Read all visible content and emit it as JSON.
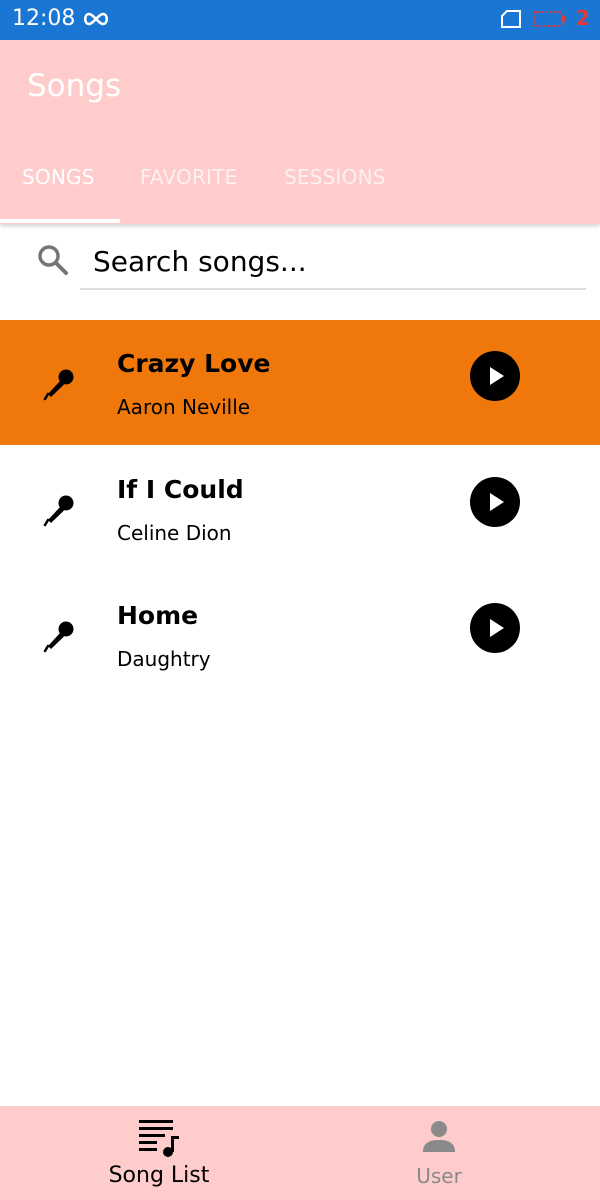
{
  "status_bar": {
    "time": "12:08",
    "battery_level": "2",
    "color": "#1976D2"
  },
  "app_bar": {
    "title": "Songs",
    "color": "#FFCCCC",
    "tabs": [
      {
        "label": "SONGS",
        "active": true
      },
      {
        "label": "FAVORITE",
        "active": false
      },
      {
        "label": "SESSIONS",
        "active": false
      }
    ]
  },
  "search": {
    "placeholder": "Search songs...",
    "value": "",
    "icon": "search-icon"
  },
  "songs": [
    {
      "title": "Crazy Love",
      "artist": "Aaron Neville",
      "selected": true,
      "icon": "microphone-icon"
    },
    {
      "title": "If I Could",
      "artist": "Celine Dion",
      "selected": false,
      "icon": "microphone-icon"
    },
    {
      "title": "Home",
      "artist": "Daughtry",
      "selected": false,
      "icon": "microphone-icon"
    }
  ],
  "selected_color": "#F0780A",
  "bottom_nav": {
    "items": [
      {
        "label": "Song List",
        "active": true,
        "icon": "music-list-icon"
      },
      {
        "label": "User",
        "active": false,
        "icon": "person-icon"
      }
    ]
  }
}
